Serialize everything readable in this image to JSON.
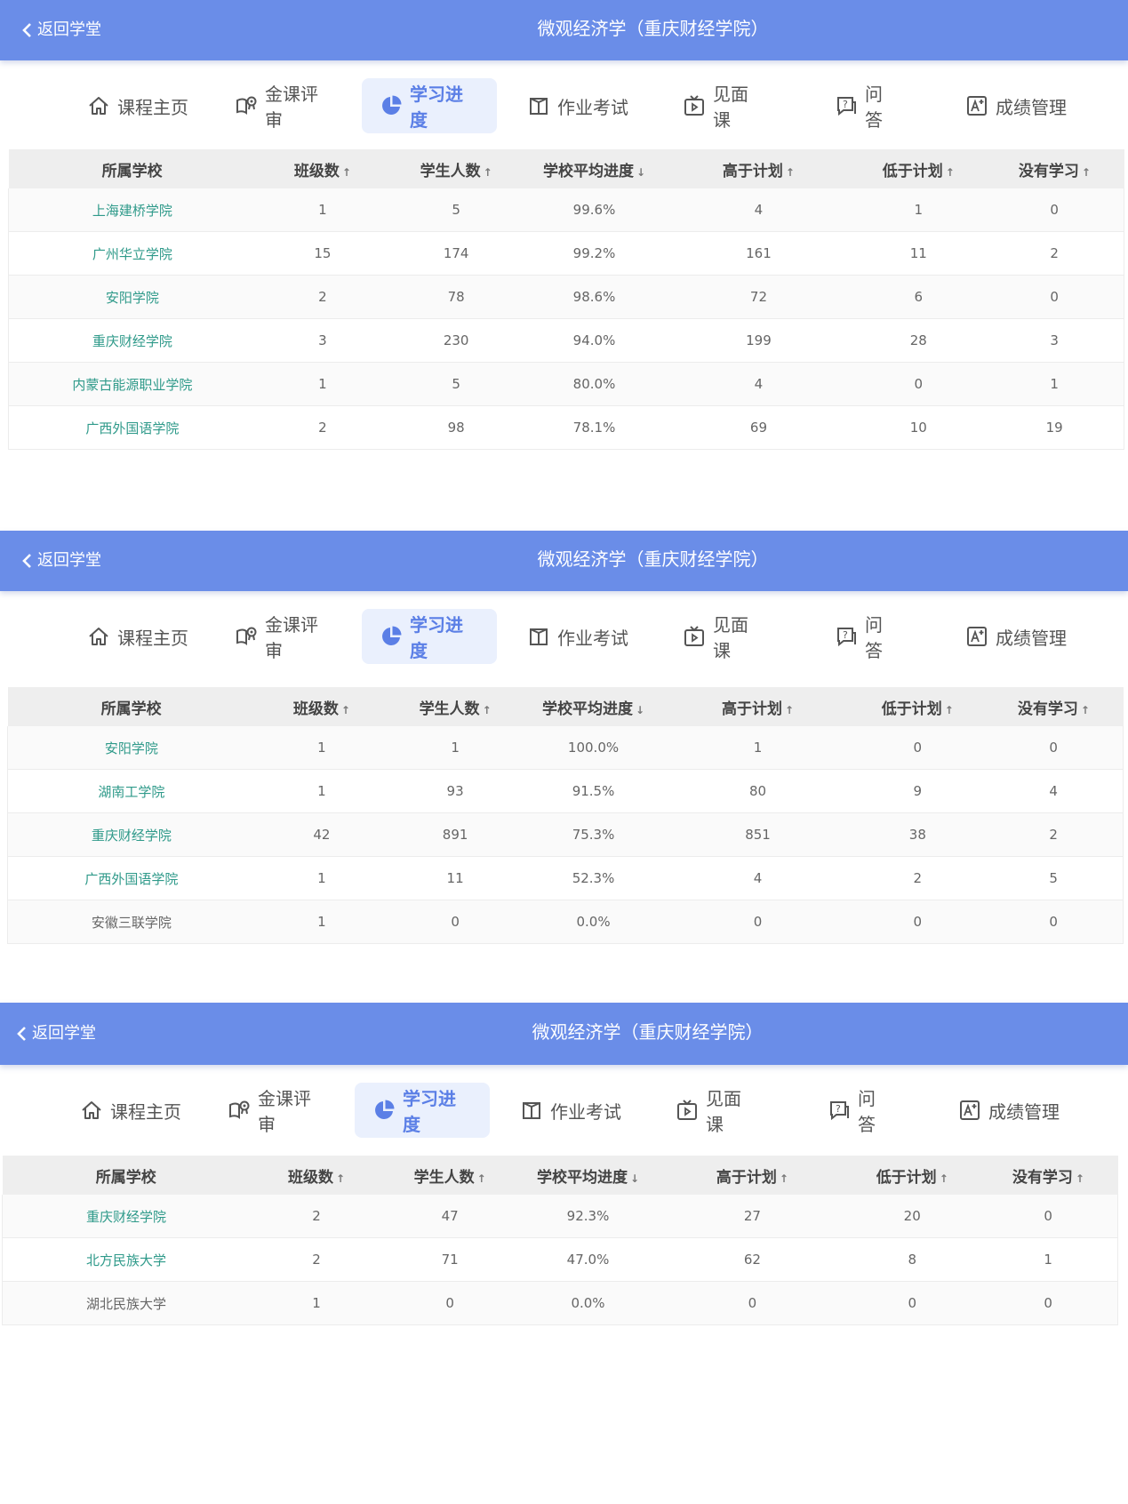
{
  "back_label": "返回学堂",
  "course_title": "微观经济学（重庆财经学院）",
  "tabs": [
    {
      "label": "课程主页",
      "icon": "home-icon"
    },
    {
      "label": "金课评审",
      "icon": "review-icon"
    },
    {
      "label": "学习进度",
      "icon": "pie-chart-icon",
      "active": true
    },
    {
      "label": "作业考试",
      "icon": "book-icon"
    },
    {
      "label": "见面课",
      "icon": "video-icon"
    },
    {
      "label": "问答",
      "icon": "qa-icon"
    },
    {
      "label": "成绩管理",
      "icon": "grade-icon"
    }
  ],
  "columns": [
    "所属学校",
    "班级数",
    "学生人数",
    "学校平均进度",
    "高于计划",
    "低于计划",
    "没有学习"
  ],
  "column_sort_arrows": [
    "",
    "↑",
    "↑",
    "↓",
    "↑",
    "↑",
    "↑"
  ],
  "panels": [
    {
      "rows": [
        [
          "上海建桥学院",
          "1",
          "5",
          "99.6%",
          "4",
          "1",
          "0"
        ],
        [
          "广州华立学院",
          "15",
          "174",
          "99.2%",
          "161",
          "11",
          "2"
        ],
        [
          "安阳学院",
          "2",
          "78",
          "98.6%",
          "72",
          "6",
          "0"
        ],
        [
          "重庆财经学院",
          "3",
          "230",
          "94.0%",
          "199",
          "28",
          "3"
        ],
        [
          "内蒙古能源职业学院",
          "1",
          "5",
          "80.0%",
          "4",
          "0",
          "1"
        ],
        [
          "广西外国语学院",
          "2",
          "98",
          "78.1%",
          "69",
          "10",
          "19"
        ]
      ]
    },
    {
      "rows": [
        [
          "安阳学院",
          "1",
          "1",
          "100.0%",
          "1",
          "0",
          "0"
        ],
        [
          "湖南工学院",
          "1",
          "93",
          "91.5%",
          "80",
          "9",
          "4"
        ],
        [
          "重庆财经学院",
          "42",
          "891",
          "75.3%",
          "851",
          "38",
          "2"
        ],
        [
          "广西外国语学院",
          "1",
          "11",
          "52.3%",
          "4",
          "2",
          "5"
        ],
        [
          "安徽三联学院",
          "1",
          "0",
          "0.0%",
          "0",
          "0",
          "0"
        ]
      ]
    },
    {
      "rows": [
        [
          "重庆财经学院",
          "2",
          "47",
          "92.3%",
          "27",
          "20",
          "0"
        ],
        [
          "北方民族大学",
          "2",
          "71",
          "47.0%",
          "62",
          "8",
          "1"
        ],
        [
          "湖北民族大学",
          "1",
          "0",
          "0.0%",
          "0",
          "0",
          "0"
        ]
      ]
    }
  ],
  "colors": {
    "header": "#6a8de8",
    "active_tab_bg": "#eaf0fd",
    "active_tab_text": "#5b7fe6",
    "school_link": "#2f9a8a"
  }
}
